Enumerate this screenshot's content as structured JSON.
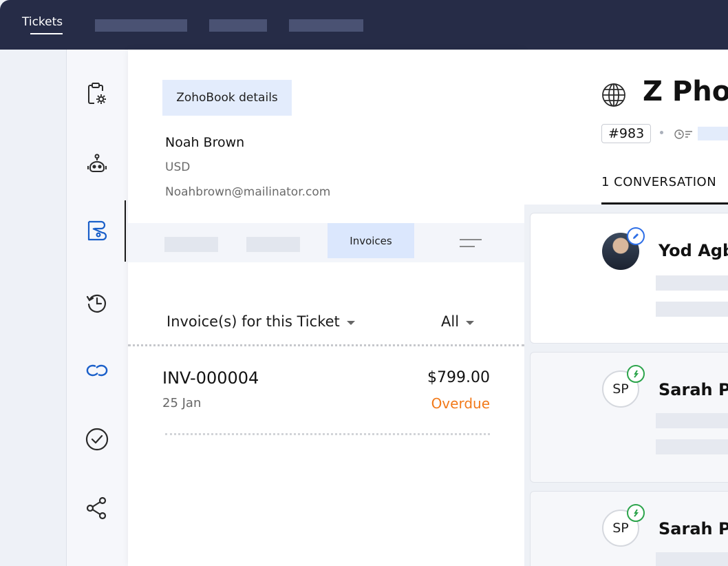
{
  "topbar": {
    "active_tab": "Tickets"
  },
  "rail": {
    "icons": [
      "clipboard-gear-icon",
      "bot-icon",
      "zohobooks-icon",
      "history-icon",
      "link-icon",
      "check-circle-icon",
      "share-icon"
    ],
    "active": "zohobooks-icon"
  },
  "panel": {
    "title_button": "ZohoBook details",
    "customer": {
      "name": "Noah Brown",
      "currency": "USD",
      "email": "Noahbrown@mailinator.com"
    },
    "subtabs": {
      "active": "Invoices"
    },
    "invoice_heading": "Invoice(s) for this Ticket",
    "filter": "All",
    "invoice": {
      "number": "INV-000004",
      "amount": "$799.00",
      "date": "25 Jan",
      "status": "Overdue"
    }
  },
  "ticket": {
    "title": "Z Phon",
    "id": "#983",
    "conversation_tab": "1 CONVERSATION",
    "threads": [
      {
        "initials": "",
        "name": "Yod Agb",
        "badge": "edit-icon"
      },
      {
        "initials": "SP",
        "name": "Sarah Pa",
        "badge": "incoming-icon"
      },
      {
        "initials": "SP",
        "name": "Sarah Pa",
        "badge": "incoming-icon"
      }
    ]
  },
  "colors": {
    "topbar": "#262c47",
    "accent_blue": "#1a5fc9",
    "overdue": "#f27a1a",
    "active_tab_bg": "#dbe7fd"
  }
}
